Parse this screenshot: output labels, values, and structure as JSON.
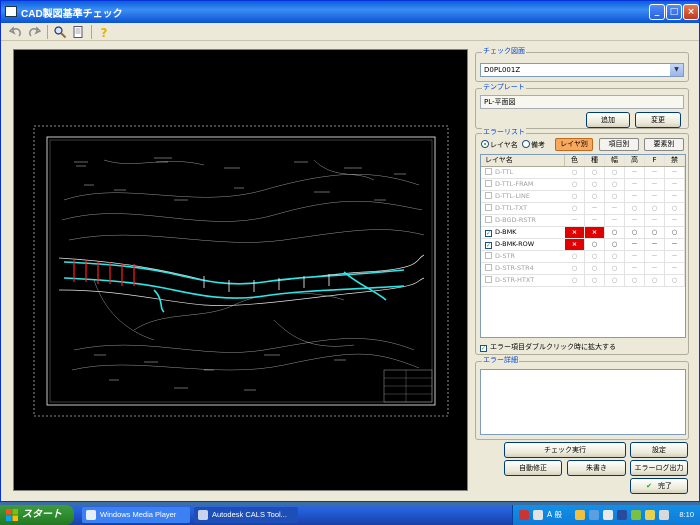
{
  "window": {
    "title": "CAD製図基準チェック",
    "buttons": {
      "minimize": "_",
      "maximize": "□",
      "close": "×"
    }
  },
  "toolbar": {
    "icons": [
      "undo-icon",
      "redo-icon",
      "search-icon",
      "document-icon",
      "help-icon"
    ]
  },
  "check_drawing": {
    "label": "チェック図面",
    "value": "D0PL001Z"
  },
  "template": {
    "label": "テンプレート",
    "value": "PL-平面図",
    "add_label": "追加",
    "change_label": "変更"
  },
  "error_list": {
    "label": "エラーリスト",
    "radio_layer": "レイヤ名",
    "radio_note": "備考",
    "tabs": [
      "レイヤ別",
      "項目別",
      "要素別"
    ],
    "headers": [
      "レイヤ名",
      "色",
      "種",
      "幅",
      "高",
      "F",
      "禁"
    ],
    "rows": [
      {
        "name": "D-TTL",
        "checked": false,
        "enabled": false,
        "cells": [
          "○",
          "○",
          "○",
          "－",
          "－",
          "－"
        ]
      },
      {
        "name": "D-TTL-FRAM",
        "checked": false,
        "enabled": false,
        "cells": [
          "○",
          "○",
          "○",
          "－",
          "－",
          "－"
        ]
      },
      {
        "name": "D-TTL-LINE",
        "checked": false,
        "enabled": false,
        "cells": [
          "○",
          "○",
          "○",
          "－",
          "－",
          "－"
        ]
      },
      {
        "name": "D-TTL-TXT",
        "checked": false,
        "enabled": false,
        "cells": [
          "○",
          "－",
          "－",
          "○",
          "○",
          "○"
        ]
      },
      {
        "name": "D-BGD-RSTR",
        "checked": false,
        "enabled": false,
        "cells": [
          "－",
          "－",
          "－",
          "－",
          "－",
          "－"
        ]
      },
      {
        "name": "D-BMK",
        "checked": true,
        "enabled": true,
        "cells": [
          "×",
          "×",
          "○",
          "○",
          "○",
          "○"
        ]
      },
      {
        "name": "D-BMK-ROW",
        "checked": true,
        "enabled": true,
        "cells": [
          "×",
          "○",
          "○",
          "－",
          "－",
          "－"
        ]
      },
      {
        "name": "D-STR",
        "checked": false,
        "enabled": false,
        "cells": [
          "○",
          "○",
          "○",
          "－",
          "－",
          "－"
        ]
      },
      {
        "name": "D-STR-STR4",
        "checked": false,
        "enabled": false,
        "cells": [
          "○",
          "○",
          "○",
          "－",
          "－",
          "－"
        ]
      },
      {
        "name": "D-STR-HTXT",
        "checked": false,
        "enabled": false,
        "cells": [
          "○",
          "○",
          "○",
          "○",
          "○",
          "○"
        ]
      }
    ],
    "expand_label": "エラー項目ダブルクリック時に拡大する",
    "expand_checked": "✓"
  },
  "error_detail": {
    "label": "エラー詳細",
    "text": ""
  },
  "actions": {
    "run_check": "チェック実行",
    "settings": "設定",
    "auto_fix": "自動修正",
    "red_mark": "朱書き",
    "error_log": "エラーログ出力",
    "done": "完了",
    "done_icon": "✔"
  },
  "taskbar": {
    "start_label": "スタート",
    "tasks": [
      "Windows Media Player",
      "Autodesk CALS Tool..."
    ],
    "tray_text": "A 般",
    "clock": "8:10"
  },
  "colors": {
    "titlebar": "#0a5fdc",
    "active_tab": "#f9a860",
    "error_cell": "#e00000",
    "cad_route": "#2ee6e6",
    "cad_marks": "#ff2020"
  }
}
